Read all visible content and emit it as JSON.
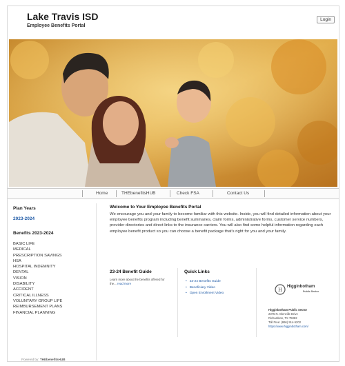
{
  "header": {
    "title": "Lake Travis ISD",
    "subtitle": "Employee Benefits Portal",
    "login_label": "Login"
  },
  "nav": [
    "Home",
    "THEbenefitsHUB",
    "Check FSA",
    "Contact Us"
  ],
  "left": {
    "plan_years_heading": "Plan Years",
    "plan_year": "2023-2024",
    "benefits_heading": "Benefits 2023-2024",
    "benefits": [
      "BASIC LIFE",
      "MEDICAL",
      "PRESCRIPTION SAVINGS",
      "HSA",
      "HOSPITAL INDEMNITY",
      "DENTAL",
      "VISION",
      "DISABILITY",
      "ACCIDENT",
      "CRITICAL ILLNESS",
      "VOLUNTARY GROUP LIFE",
      "REIMBURSEMENT PLANS",
      "FINANCIAL PLANNING"
    ]
  },
  "welcome": {
    "title": "Welcome to Your Employee Benefits Portal",
    "body": "We encourage you and your family to become familiar with this website. Inside, you will find detailed information about your employee benefits program including benefit summaries, claim forms, administrative forms, customer service numbers, provider directories and direct links to the insurance carriers. You will also find some helpful information regarding each employee benefit product so you can choose a benefit package that's right for you and your family."
  },
  "guide": {
    "title": "23-24 Benefit Guide",
    "text": "Learn more about the benefits offered for the...",
    "read_more": "read more"
  },
  "quick_links": {
    "title": "Quick Links",
    "items": [
      "23-24 Benefits Guide",
      "Beneficiary Video",
      "Open Enrollment Video"
    ]
  },
  "provider": {
    "logo_name": "Higginbotham",
    "logo_tagline": "Public Sector",
    "name": "Higginbotham Public Sector",
    "street": "2375 N. Glenville Drive",
    "city": "Richardson, TX 75082",
    "phone": "Toll Free: (866) 914-5202",
    "url": "https://www.higginbotham.com/"
  },
  "footer": {
    "prefix": "Powered by:",
    "brand": "THEbenefitsHUB"
  },
  "colors": {
    "link": "#1f5aa6",
    "foliage": "#d99a2b"
  }
}
